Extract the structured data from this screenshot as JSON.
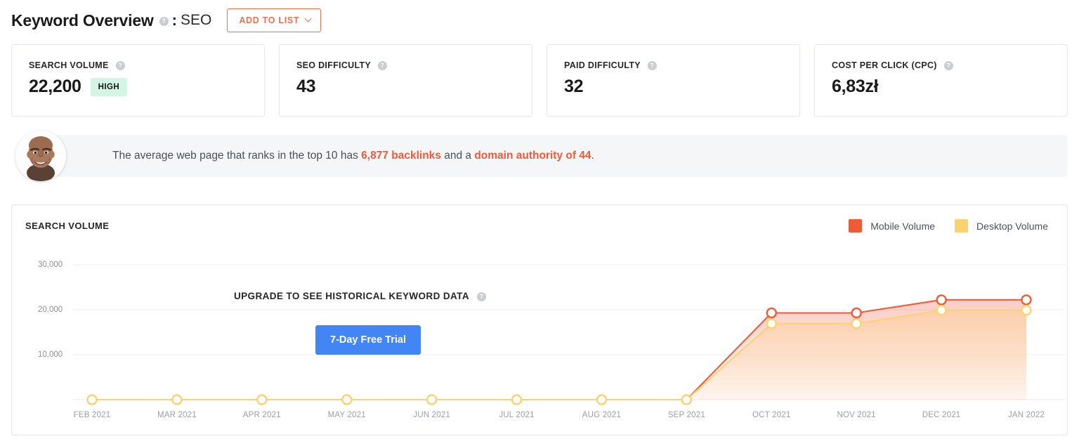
{
  "header": {
    "title": "Keyword Overview",
    "help_icon": "help-icon",
    "separator": ":",
    "keyword": "SEO",
    "add_to_list_label": "ADD TO LIST",
    "accent_color": "#ef6f4a"
  },
  "metrics": [
    {
      "label": "SEARCH VOLUME",
      "value": "22,200",
      "badge": "HIGH",
      "badge_color": "#d3f5e3"
    },
    {
      "label": "SEO DIFFICULTY",
      "value": "43",
      "badge": null
    },
    {
      "label": "PAID DIFFICULTY",
      "value": "32",
      "badge": null
    },
    {
      "label": "COST PER CLICK (CPC)",
      "value": "6,83zł",
      "badge": null
    }
  ],
  "insight": {
    "avatar": "user-avatar-photo",
    "text_part1": "The average web page that ranks in the top 10 has ",
    "highlight1": "6,877 backlinks",
    "text_part2": " and a ",
    "highlight2": "domain authority of 44",
    "text_part3": ".",
    "highlight_color": "#ef5a37"
  },
  "chart_panel": {
    "title": "SEARCH VOLUME",
    "legend": [
      {
        "label": "Mobile Volume",
        "color": "#ef5a37"
      },
      {
        "label": "Desktop Volume",
        "color": "#fcd270"
      }
    ],
    "overlay": {
      "upgrade_text": "UPGRADE TO SEE HISTORICAL KEYWORD DATA",
      "help_icon": "help-icon",
      "trial_button": "7-Day Free Trial",
      "trial_button_color": "#4285f4"
    }
  },
  "chart_data": {
    "type": "area",
    "title": "SEARCH VOLUME",
    "xlabel": "",
    "ylabel": "",
    "ylim": [
      0,
      32000
    ],
    "yticks": [
      10000,
      20000,
      30000
    ],
    "ytick_labels": [
      "10,000",
      "20,000",
      "30,000"
    ],
    "grid": true,
    "legend_position": "top-right",
    "categories": [
      "FEB 2021",
      "MAR 2021",
      "APR 2021",
      "MAY 2021",
      "JUN 2021",
      "JUL 2021",
      "AUG 2021",
      "SEP 2021",
      "OCT 2021",
      "NOV 2021",
      "DEC 2021",
      "JAN 2022"
    ],
    "series": [
      {
        "name": "Mobile Volume",
        "color": "#ef5a37",
        "values": [
          0,
          0,
          0,
          0,
          0,
          0,
          0,
          0,
          19300,
          19300,
          22200,
          22200
        ]
      },
      {
        "name": "Desktop Volume",
        "color": "#fcd270",
        "values": [
          0,
          0,
          0,
          0,
          0,
          0,
          0,
          0,
          16900,
          16900,
          19900,
          19900
        ]
      }
    ]
  }
}
